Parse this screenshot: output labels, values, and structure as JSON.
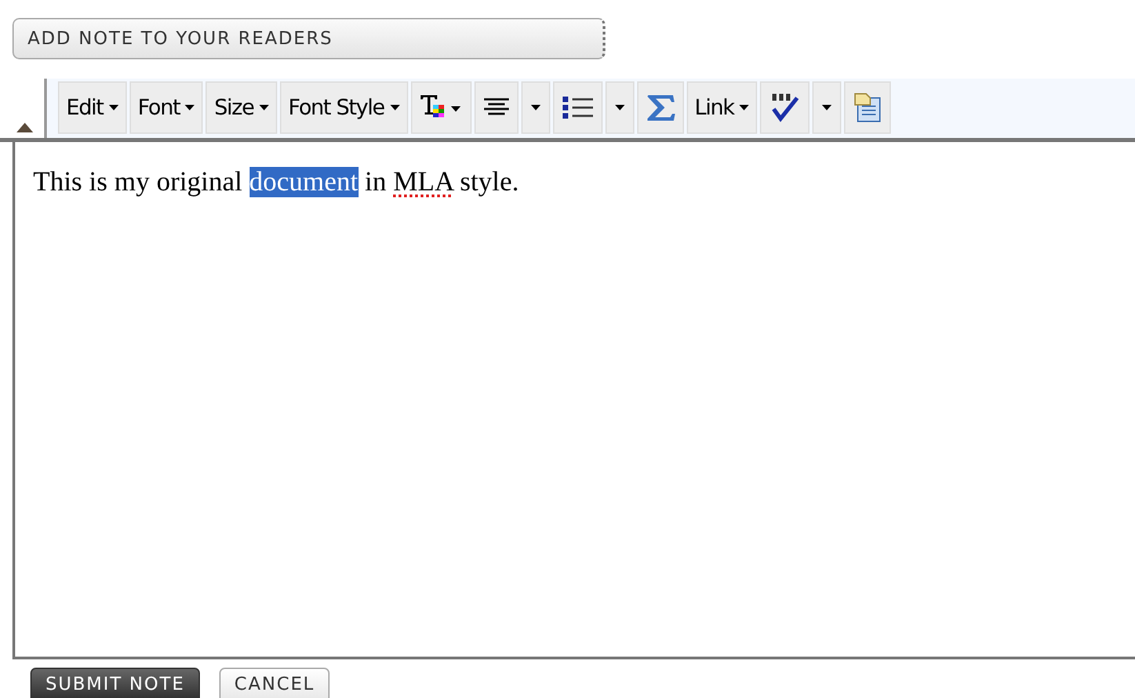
{
  "note_button": {
    "label": "ADD NOTE TO YOUR READERS"
  },
  "toolbar": {
    "collapsed": false,
    "items": [
      {
        "kind": "menu",
        "label": "Edit"
      },
      {
        "kind": "menu",
        "label": "Font"
      },
      {
        "kind": "menu",
        "label": "Size"
      },
      {
        "kind": "menu",
        "label": "Font Style"
      },
      {
        "kind": "textcolor"
      },
      {
        "kind": "align"
      },
      {
        "kind": "caret"
      },
      {
        "kind": "list"
      },
      {
        "kind": "caret"
      },
      {
        "kind": "sigma"
      },
      {
        "kind": "menu",
        "label": "Link"
      },
      {
        "kind": "spell"
      },
      {
        "kind": "caret"
      },
      {
        "kind": "clipboard"
      }
    ]
  },
  "editor": {
    "segments": [
      {
        "text": "This is my original ",
        "selected": false,
        "misspelled": false
      },
      {
        "text": "document",
        "selected": true,
        "misspelled": false
      },
      {
        "text": " in ",
        "selected": false,
        "misspelled": false
      },
      {
        "text": "MLA",
        "selected": false,
        "misspelled": true
      },
      {
        "text": " style.",
        "selected": false,
        "misspelled": false
      }
    ]
  },
  "buttons": [
    {
      "label": "SUBMIT NOTE",
      "primary": true
    },
    {
      "label": "CANCEL",
      "primary": false
    }
  ]
}
